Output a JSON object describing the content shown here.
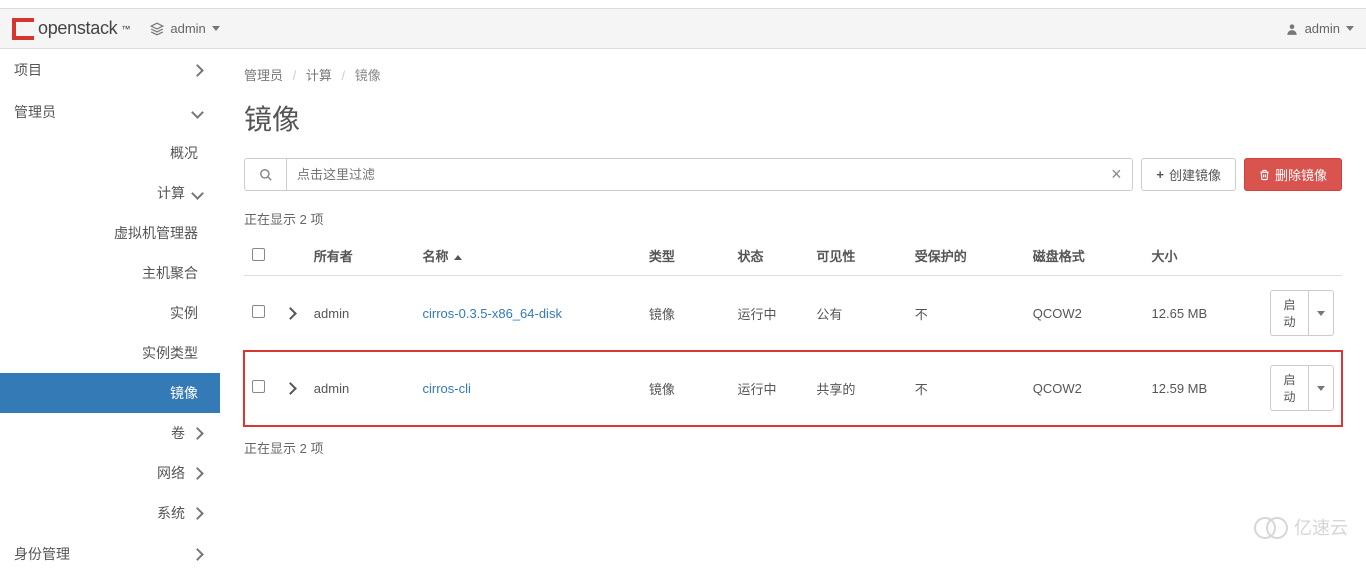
{
  "top": {
    "logo_text": "openstack",
    "trade": "™",
    "project_prefix_icon": "layers",
    "project_name": "admin",
    "user_name": "admin"
  },
  "sidebar": {
    "project": "项目",
    "admin": "管理员",
    "overview": "概况",
    "compute": "计算",
    "hypervisors": "虚拟机管理器",
    "host_aggregates": "主机聚合",
    "instances": "实例",
    "flavors": "实例类型",
    "images": "镜像",
    "volume": "卷",
    "network": "网络",
    "system": "系统",
    "identity": "身份管理"
  },
  "breadcrumb": {
    "b1": "管理员",
    "b2": "计算",
    "b3": "镜像"
  },
  "title": "镜像",
  "search": {
    "placeholder": "点击这里过滤"
  },
  "buttons": {
    "create": "创建镜像",
    "delete": "删除镜像"
  },
  "count_text_top": "正在显示 2 项",
  "count_text_bottom": "正在显示 2 项",
  "columns": {
    "owner": "所有者",
    "name": "名称",
    "type": "类型",
    "status": "状态",
    "visibility": "可见性",
    "protected": "受保护的",
    "format": "磁盘格式",
    "size": "大小"
  },
  "rows": [
    {
      "owner": "admin",
      "name": "cirros-0.3.5-x86_64-disk",
      "type": "镜像",
      "status": "运行中",
      "visibility": "公有",
      "protected": "不",
      "format": "QCOW2",
      "size": "12.65 MB",
      "action": "启动"
    },
    {
      "owner": "admin",
      "name": "cirros-cli",
      "type": "镜像",
      "status": "运行中",
      "visibility": "共享的",
      "protected": "不",
      "format": "QCOW2",
      "size": "12.59 MB",
      "action": "启动"
    }
  ],
  "watermark": "亿速云"
}
